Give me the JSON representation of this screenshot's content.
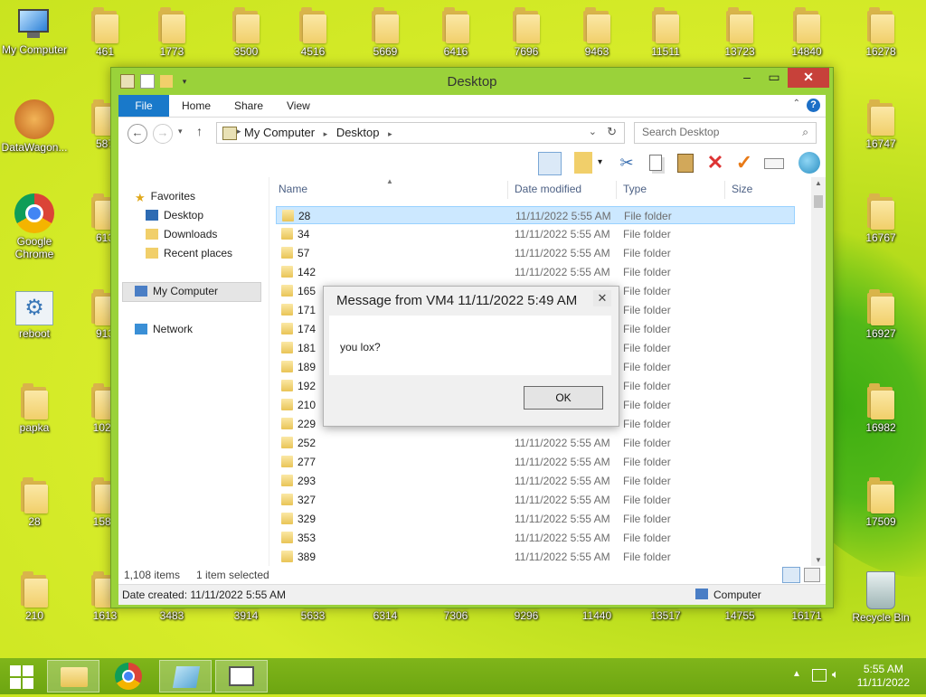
{
  "desktop": {
    "icons": [
      {
        "label": "My Computer",
        "type": "computer"
      },
      {
        "label": "461",
        "type": "folder"
      },
      {
        "label": "1773",
        "type": "folder"
      },
      {
        "label": "3500",
        "type": "folder"
      },
      {
        "label": "4516",
        "type": "folder"
      },
      {
        "label": "5669",
        "type": "folder"
      },
      {
        "label": "6416",
        "type": "folder"
      },
      {
        "label": "7696",
        "type": "folder"
      },
      {
        "label": "9463",
        "type": "folder"
      },
      {
        "label": "11511",
        "type": "folder"
      },
      {
        "label": "13723",
        "type": "folder"
      },
      {
        "label": "14840",
        "type": "folder"
      },
      {
        "label": "16278",
        "type": "folder"
      },
      {
        "label": "DataWagon...",
        "type": "app"
      },
      {
        "label": "587",
        "type": "folder"
      },
      {
        "label": "16747",
        "type": "folder"
      },
      {
        "label": "Google Chrome",
        "type": "chrome"
      },
      {
        "label": "613",
        "type": "folder"
      },
      {
        "label": "16767",
        "type": "folder"
      },
      {
        "label": "reboot",
        "type": "gear"
      },
      {
        "label": "913",
        "type": "folder"
      },
      {
        "label": "16927",
        "type": "folder"
      },
      {
        "label": "papka",
        "type": "folder"
      },
      {
        "label": "1024",
        "type": "folder"
      },
      {
        "label": "16982",
        "type": "folder"
      },
      {
        "label": "28",
        "type": "folder"
      },
      {
        "label": "1588",
        "type": "folder"
      },
      {
        "label": "17509",
        "type": "folder"
      },
      {
        "label": "210",
        "type": "folder"
      },
      {
        "label": "1613",
        "type": "folder"
      },
      {
        "label": "3483",
        "type": "folder"
      },
      {
        "label": "3914",
        "type": "folder"
      },
      {
        "label": "5633",
        "type": "folder"
      },
      {
        "label": "6314",
        "type": "folder"
      },
      {
        "label": "7306",
        "type": "folder"
      },
      {
        "label": "9296",
        "type": "folder"
      },
      {
        "label": "11440",
        "type": "folder"
      },
      {
        "label": "13517",
        "type": "folder"
      },
      {
        "label": "14755",
        "type": "folder"
      },
      {
        "label": "16171",
        "type": "folder"
      },
      {
        "label": "Recycle Bin",
        "type": "recycle"
      }
    ]
  },
  "explorer": {
    "title": "Desktop",
    "ribbon_tabs": {
      "file": "File",
      "home": "Home",
      "share": "Share",
      "view": "View"
    },
    "help": "?",
    "breadcrumb": {
      "root": "My Computer",
      "current": "Desktop"
    },
    "search_placeholder": "Search Desktop",
    "nav": {
      "favorites": "Favorites",
      "desktop": "Desktop",
      "downloads": "Downloads",
      "recent": "Recent places",
      "computer": "My Computer",
      "network": "Network"
    },
    "columns": {
      "name": "Name",
      "date": "Date modified",
      "type": "Type",
      "size": "Size"
    },
    "files": [
      {
        "name": "28",
        "date": "11/11/2022 5:55 AM",
        "type": "File folder",
        "selected": true
      },
      {
        "name": "34",
        "date": "11/11/2022 5:55 AM",
        "type": "File folder"
      },
      {
        "name": "57",
        "date": "11/11/2022 5:55 AM",
        "type": "File folder"
      },
      {
        "name": "142",
        "date": "11/11/2022 5:55 AM",
        "type": "File folder"
      },
      {
        "name": "165",
        "date": "",
        "type": "File folder"
      },
      {
        "name": "171",
        "date": "",
        "type": "File folder"
      },
      {
        "name": "174",
        "date": "",
        "type": "File folder"
      },
      {
        "name": "181",
        "date": "",
        "type": "File folder"
      },
      {
        "name": "189",
        "date": "",
        "type": "File folder"
      },
      {
        "name": "192",
        "date": "",
        "type": "File folder"
      },
      {
        "name": "210",
        "date": "",
        "type": "File folder"
      },
      {
        "name": "229",
        "date": "",
        "type": "File folder"
      },
      {
        "name": "252",
        "date": "11/11/2022 5:55 AM",
        "type": "File folder"
      },
      {
        "name": "277",
        "date": "11/11/2022 5:55 AM",
        "type": "File folder"
      },
      {
        "name": "293",
        "date": "11/11/2022 5:55 AM",
        "type": "File folder"
      },
      {
        "name": "327",
        "date": "11/11/2022 5:55 AM",
        "type": "File folder"
      },
      {
        "name": "329",
        "date": "11/11/2022 5:55 AM",
        "type": "File folder"
      },
      {
        "name": "353",
        "date": "11/11/2022 5:55 AM",
        "type": "File folder"
      },
      {
        "name": "389",
        "date": "11/11/2022 5:55 AM",
        "type": "File folder"
      }
    ],
    "status": {
      "count": "1,108 items",
      "selected": "1 item selected"
    },
    "details": {
      "created": "Date created: 11/11/2022 5:55 AM",
      "location": "Computer"
    }
  },
  "dialog": {
    "title": "Message from VM4 11/11/2022 5:49 AM",
    "message": "you lox?",
    "ok": "OK"
  },
  "taskbar": {
    "time": "5:55 AM",
    "date": "11/11/2022"
  },
  "colors": {
    "accent": "#1979ca",
    "close": "#c7413a",
    "selection": "#cce8ff"
  }
}
